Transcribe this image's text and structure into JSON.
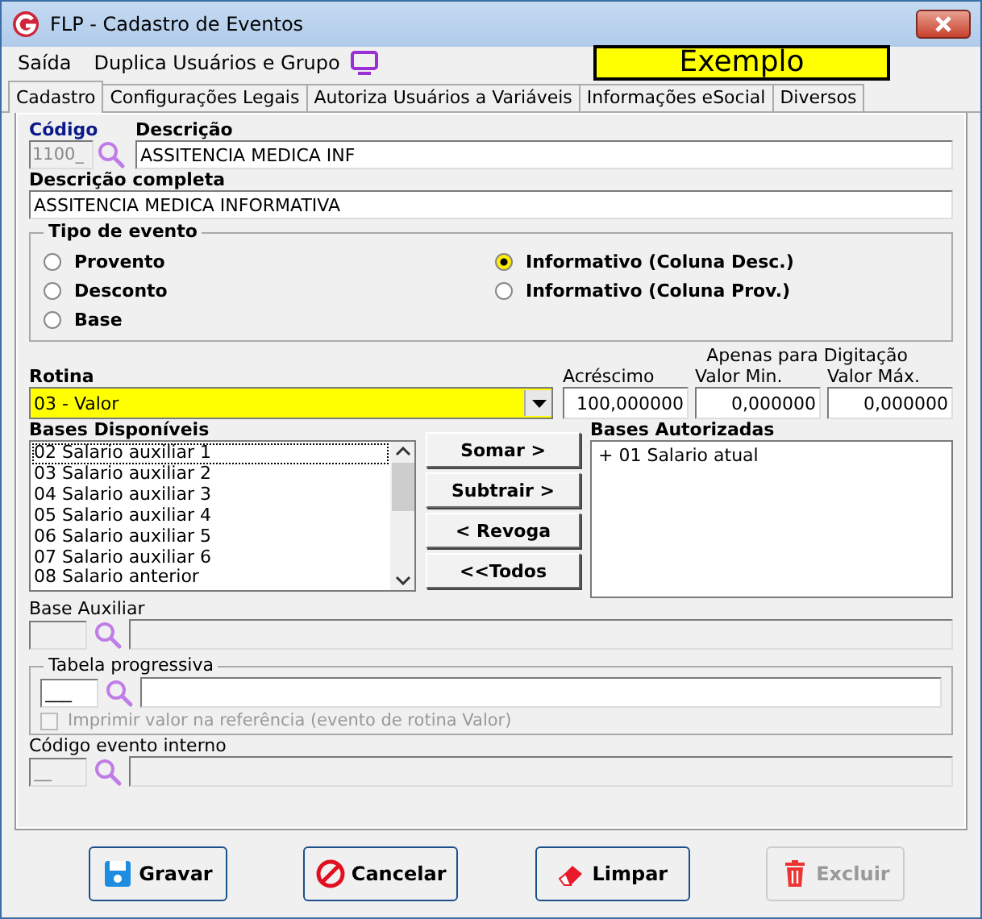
{
  "window": {
    "title": "FLP - Cadastro de Eventos"
  },
  "menu": [
    {
      "label": "Saída"
    },
    {
      "label": "Duplica Usuários e Grupo"
    }
  ],
  "banner": "Exemplo",
  "tabs": [
    {
      "label": "Cadastro",
      "selected": true
    },
    {
      "label": "Configurações Legais",
      "selected": false
    },
    {
      "label": "Autoriza Usuários a Variáveis",
      "selected": false
    },
    {
      "label": "Informações eSocial",
      "selected": false
    },
    {
      "label": "Diversos",
      "selected": false
    }
  ],
  "codigo": {
    "label": "Código",
    "value": "1100_",
    "disabled": true
  },
  "descricao": {
    "label": "Descrição",
    "value": "ASSITENCIA MEDICA INF"
  },
  "descricao_completa": {
    "label": "Descrição completa",
    "value": "ASSITENCIA MEDICA INFORMATIVA"
  },
  "tipo_evento": {
    "title": "Tipo de evento",
    "options": [
      {
        "label": "Provento",
        "selected": false
      },
      {
        "label": "Desconto",
        "selected": false
      },
      {
        "label": "Base",
        "selected": false
      },
      {
        "label": "Informativo (Coluna Desc.)",
        "selected": true
      },
      {
        "label": "Informativo (Coluna Prov.)",
        "selected": false
      }
    ]
  },
  "rotina": {
    "label": "Rotina",
    "value": "03 - Valor"
  },
  "digitacao_note": "Apenas para Digitação",
  "acrescimo": {
    "label": "Acréscimo",
    "value": "100,000000"
  },
  "valor_min": {
    "label": "Valor Min.",
    "value": "0,000000"
  },
  "valor_max": {
    "label": "Valor Máx.",
    "value": "0,000000"
  },
  "bases_disponiveis": {
    "label": "Bases Disponíveis",
    "items": [
      {
        "label": "02 Salario auxiliar 1",
        "focused": true
      },
      {
        "label": "03 Salario auxiliar 2",
        "focused": false
      },
      {
        "label": "04 Salario auxiliar 3",
        "focused": false
      },
      {
        "label": "05 Salario auxiliar 4",
        "focused": false
      },
      {
        "label": "06 Salario auxiliar 5",
        "focused": false
      },
      {
        "label": "07 Salario auxiliar 6",
        "focused": false
      },
      {
        "label": "08 Salario anterior",
        "focused": false
      }
    ]
  },
  "transfer_buttons": [
    {
      "label": "Somar >"
    },
    {
      "label": "Subtrair >"
    },
    {
      "label": "< Revoga"
    },
    {
      "label": "<<Todos"
    }
  ],
  "bases_autorizadas": {
    "label": "Bases Autorizadas",
    "items": [
      {
        "label": "+ 01 Salario atual"
      }
    ]
  },
  "base_auxiliar": {
    "label": "Base Auxiliar",
    "disabled": true
  },
  "tabela_progressiva": {
    "title": "Tabela progressiva",
    "code": "___",
    "disabled": false,
    "checkbox": {
      "label": "Imprimir valor na referência (evento de rotina Valor)",
      "checked": false,
      "disabled": true
    }
  },
  "codigo_evento_interno": {
    "label": "Código evento interno",
    "code": "__",
    "disabled": true
  },
  "footer_buttons": [
    {
      "label": "Gravar",
      "kind": "save",
      "disabled": false
    },
    {
      "label": "Cancelar",
      "kind": "cancel",
      "disabled": false
    },
    {
      "label": "Limpar",
      "kind": "clear",
      "disabled": false
    },
    {
      "label": "Excluir",
      "kind": "delete",
      "disabled": true
    }
  ]
}
